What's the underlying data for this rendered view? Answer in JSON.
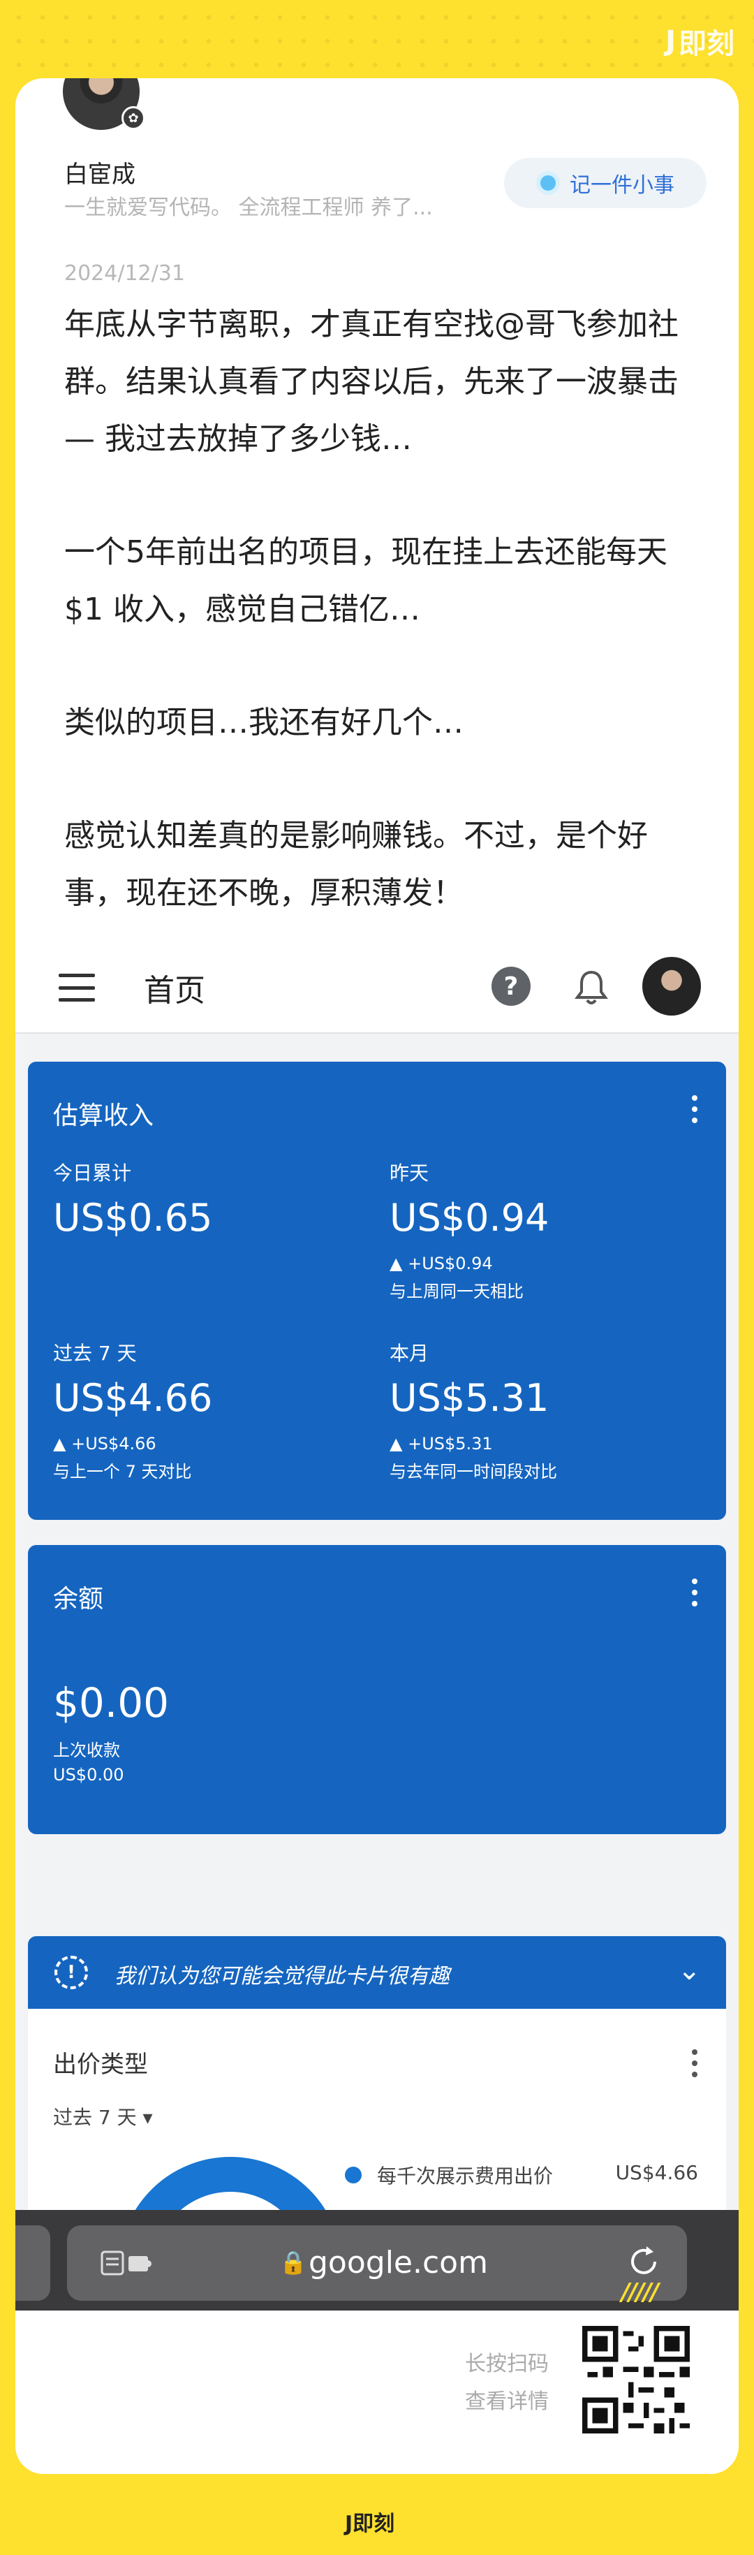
{
  "app": {
    "brand": "即刻"
  },
  "author": {
    "name": "白宦成",
    "bio": "一生就爱写代码。 全流程工程师 养了...",
    "badge_icon": "gear-icon"
  },
  "note_button": {
    "label": "记一件小事"
  },
  "post": {
    "date": "2024/12/31",
    "paragraphs": [
      "年底从字节离职，才真正有空找@哥飞参加社群。结果认真看了内容以后，先来了一波暴击— 我过去放掉了多少钱…",
      "一个5年前出名的项目，现在挂上去还能每天 $1 收入，感觉自己错亿…",
      "类似的项目…我还有好几个…",
      "感觉认知差真的是影响赚钱。不过，是个好事，现在还不晚，厚积薄发！"
    ]
  },
  "screenshot": {
    "topbar": {
      "title": "首页"
    },
    "estimated_earnings": {
      "title": "估算收入",
      "today": {
        "label": "今日累计",
        "value": "US$0.65"
      },
      "yesterday": {
        "label": "昨天",
        "value": "US$0.94",
        "change": "▲ +US$0.94",
        "compare": "与上周同一天相比"
      },
      "last7": {
        "label": "过去 7 天",
        "value": "US$4.66",
        "change": "▲ +US$4.66",
        "compare": "与上一个 7 天对比"
      },
      "month": {
        "label": "本月",
        "value": "US$5.31",
        "change": "▲ +US$5.31",
        "compare": "与去年同一时间段对比"
      }
    },
    "balance": {
      "title": "余额",
      "value": "$0.00",
      "last_payment_label": "上次收款",
      "last_payment_value": "US$0.00"
    },
    "tip": {
      "text": "我们认为您可能会觉得此卡片很有趣"
    },
    "bid_type": {
      "title": "出价类型",
      "range": "过去 7 天",
      "legend": [
        {
          "label": "每千次展示费用出价",
          "value": "US$4.66",
          "color": "#1976D2"
        }
      ]
    },
    "browser": {
      "url": "google.com"
    }
  },
  "footer": {
    "scan_line1": "长按扫码",
    "scan_line2": "查看详情",
    "slashes": "/////"
  },
  "colors": {
    "background": "#FEE02E",
    "card_blue": "#1565C0",
    "accent_blue": "#2f6fd6"
  }
}
